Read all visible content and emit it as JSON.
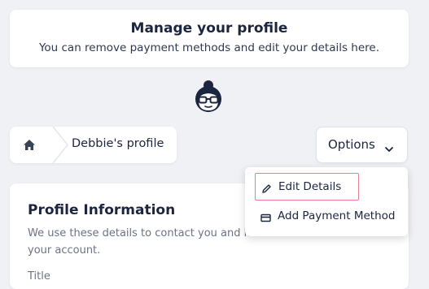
{
  "header": {
    "title": "Manage your profile",
    "subtitle": "You can remove payment methods and edit your details here."
  },
  "avatar": {
    "icon": "avatar-icon"
  },
  "breadcrumb": {
    "home_icon": "home-icon",
    "current": "Debbie's profile"
  },
  "options": {
    "label": "Options",
    "icon": "chevron-down-icon"
  },
  "dropdown": {
    "items": [
      {
        "label": "Edit Details",
        "icon": "pencil-icon",
        "highlighted": true
      },
      {
        "label": "Add Payment Method",
        "icon": "credit-card-icon",
        "highlighted": false
      }
    ]
  },
  "profile": {
    "title": "Profile Information",
    "description": "We use these details to contact you and li",
    "description_2": "your account.",
    "field_label": "Title"
  },
  "colors": {
    "background": "#f0f1f4",
    "text_dark": "#1b2540",
    "highlight_border": "#e87f8f"
  }
}
